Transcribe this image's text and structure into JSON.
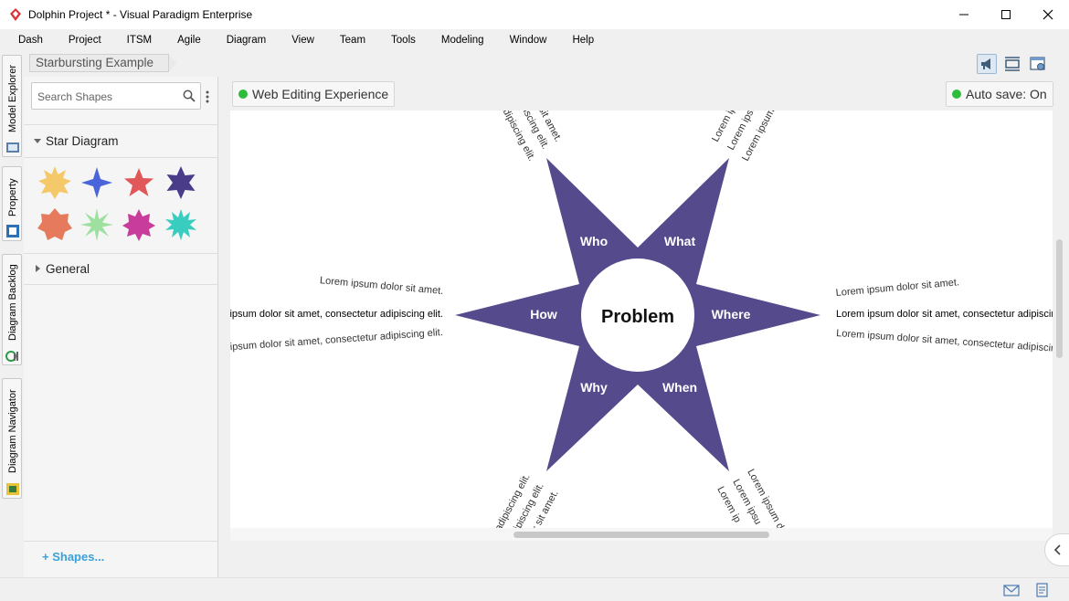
{
  "window": {
    "title": "Dolphin Project * - Visual Paradigm Enterprise"
  },
  "menu": [
    "Dash",
    "Project",
    "ITSM",
    "Agile",
    "Diagram",
    "View",
    "Team",
    "Tools",
    "Modeling",
    "Window",
    "Help"
  ],
  "breadcrumb": "Starbursting Example",
  "left_tabs": [
    "Model Explorer",
    "Property",
    "Diagram Backlog",
    "Diagram Navigator"
  ],
  "shapes_panel": {
    "search_placeholder": "Search Shapes",
    "groups": [
      {
        "name": "Star Diagram",
        "expanded": true
      },
      {
        "name": "General",
        "expanded": false
      }
    ],
    "add_shapes_label": "Shapes..."
  },
  "canvas": {
    "status_left": "Web Editing Experience",
    "status_right": "Auto save: On",
    "center_label": "Problem",
    "points": [
      "Who",
      "What",
      "Where",
      "When",
      "Why",
      "How"
    ],
    "annotations": {
      "how": [
        "Lorem ipsum dolor sit amet.",
        "ipsum dolor sit amet, consectetur adipiscing elit.",
        "ipsum dolor sit amet, consectetur adipiscing elit."
      ],
      "where": [
        "Lorem ipsum dolor sit amet.",
        "Lorem ipsum dolor sit amet, consectetur adipiscing",
        "Lorem ipsum dolor sit amet, consectetur adipiscin"
      ],
      "who": [
        "or sit amet.",
        "ipiscing elit.",
        "adipiscing elit."
      ],
      "what": [
        "Lorem ip",
        "Lorem ipsu",
        "Lorem ipsum d"
      ],
      "why": [
        "adipiscing elit.",
        "ipiscing elit.",
        "or sit amet."
      ],
      "when": [
        "Lorem ipsum do",
        "Lorem ipsu",
        "Lorem ip"
      ],
      "fragment": "!!"
    }
  },
  "colors": {
    "star": "#554a8c",
    "status_dot": "#2ebc3c",
    "accent": "#3aa0d8",
    "palette": [
      "#f5c96a",
      "#4a64dc",
      "#e0585a",
      "#4b3c8a",
      "#e67a5c",
      "#9ee0a0",
      "#c83c9c",
      "#38cdbe"
    ]
  }
}
